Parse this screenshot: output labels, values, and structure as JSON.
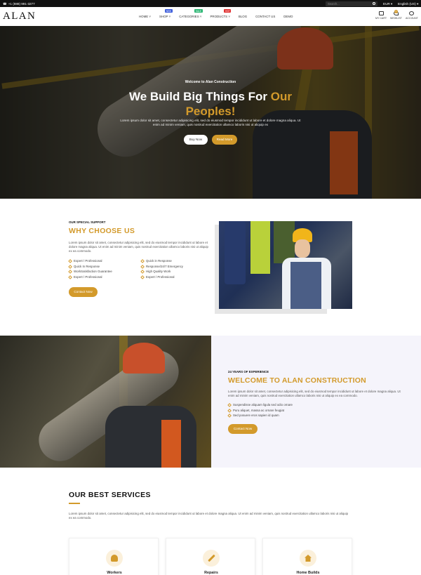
{
  "topbar": {
    "phone": "+1 (888) 991-3277",
    "search_placeholder": "Search...",
    "currency": "EUR",
    "language": "English (US)"
  },
  "header": {
    "logo": "ALAN",
    "nav": [
      {
        "label": "HOME",
        "arrow": true
      },
      {
        "label": "SHOP",
        "arrow": true,
        "badge": "NEW",
        "badge_color": "#3b5bdb"
      },
      {
        "label": "CATEGORIES",
        "arrow": true,
        "badge": "SALE",
        "badge_color": "#2bb673"
      },
      {
        "label": "PRODUCTS",
        "arrow": true,
        "badge": "HOT",
        "badge_color": "#e03131"
      },
      {
        "label": "BLOG",
        "arrow": false
      },
      {
        "label": "CONTACT US",
        "arrow": false
      },
      {
        "label": "DEMO",
        "arrow": false
      }
    ],
    "icons": {
      "cart": "MY CART",
      "wishlist": "WISHLIST",
      "wishlist_count": "0",
      "account": "ACCOUNT"
    }
  },
  "hero": {
    "eyebrow": "Welcome to Alan Construction",
    "title_main": "We Build Big Things For",
    "title_accent_1": "Our",
    "title_accent_2": "Peoples!",
    "description": "Lorem ipsum dolor sit amet, consectetur adipisicing elit, sed do eiusmod tempor incididunt ut labore et dolore magna aliqua. Ut enim ad minim veniam, quis nostrud exercitation ullamco laboris nisi ut aliquip ex",
    "buttons": {
      "buy": "Buy Now",
      "read": "Read More"
    }
  },
  "why": {
    "eyebrow": "OUR SPECIAL SUPPORT",
    "title": "WHY CHOOSE US",
    "description": "Lorem ipsum dolor sit amet, consectetur adipisicing elit, sed do eiusmod tempor incididunt ut labore et dolore magna aliqua. Ut enim ad minim veniam, quis nostrud exercitation ullamco laboris nisi ut aliquip ex ea commodo.",
    "list_left": [
      "Expert / Professional",
      "Quick In Response",
      "WorkSatisfaction Guarantee",
      "Expert / Professional"
    ],
    "list_right": [
      "Quick in Response",
      "Response/24/7 Emergency",
      "High Quality Work",
      "Expert / Professional"
    ],
    "button": "Contact Now"
  },
  "welcome": {
    "eyebrow": "24 YEARS OF EXPERIENCE",
    "title": "WELCOME TO ALAN CONSTRUCTION",
    "description": "Lorem ipsum dolor sit amet, consectetur adipisicing elit, sed do eiusmod tempor incididunt ut labore et dolore magna aliqua. Ut enim ad minim veniam, quis nostrud exercitation ullamco laboris nisi ut aliquip ex ea commodo.",
    "list": [
      "Suspendisse aliquam ligula sed odio ornare",
      "Puru aliquet, massa ac ornare feugiat",
      "Sed posuere eros sapien id quam"
    ],
    "button": "Contact Now"
  },
  "services": {
    "title": "OUR BEST SERVICES",
    "description": "Lorem ipsum dolor sit amet, consectetur adipisicing elit, sed do eiusmod tempor incididunt ut labore et dolore magna aliqua. Ut enim ad minim veniam, quis nostrud exercitation ullamco laboris nisi ut aliquip ex ea commodo.",
    "cards": [
      {
        "label": "Workers",
        "icon": "workers-icon"
      },
      {
        "label": "Repairs",
        "icon": "wrench-icon"
      },
      {
        "label": "Home Builds",
        "icon": "home-icon"
      }
    ]
  },
  "colors": {
    "accent": "#d39a2b",
    "topbar": "#111111",
    "panel": "#f5f4fb"
  }
}
